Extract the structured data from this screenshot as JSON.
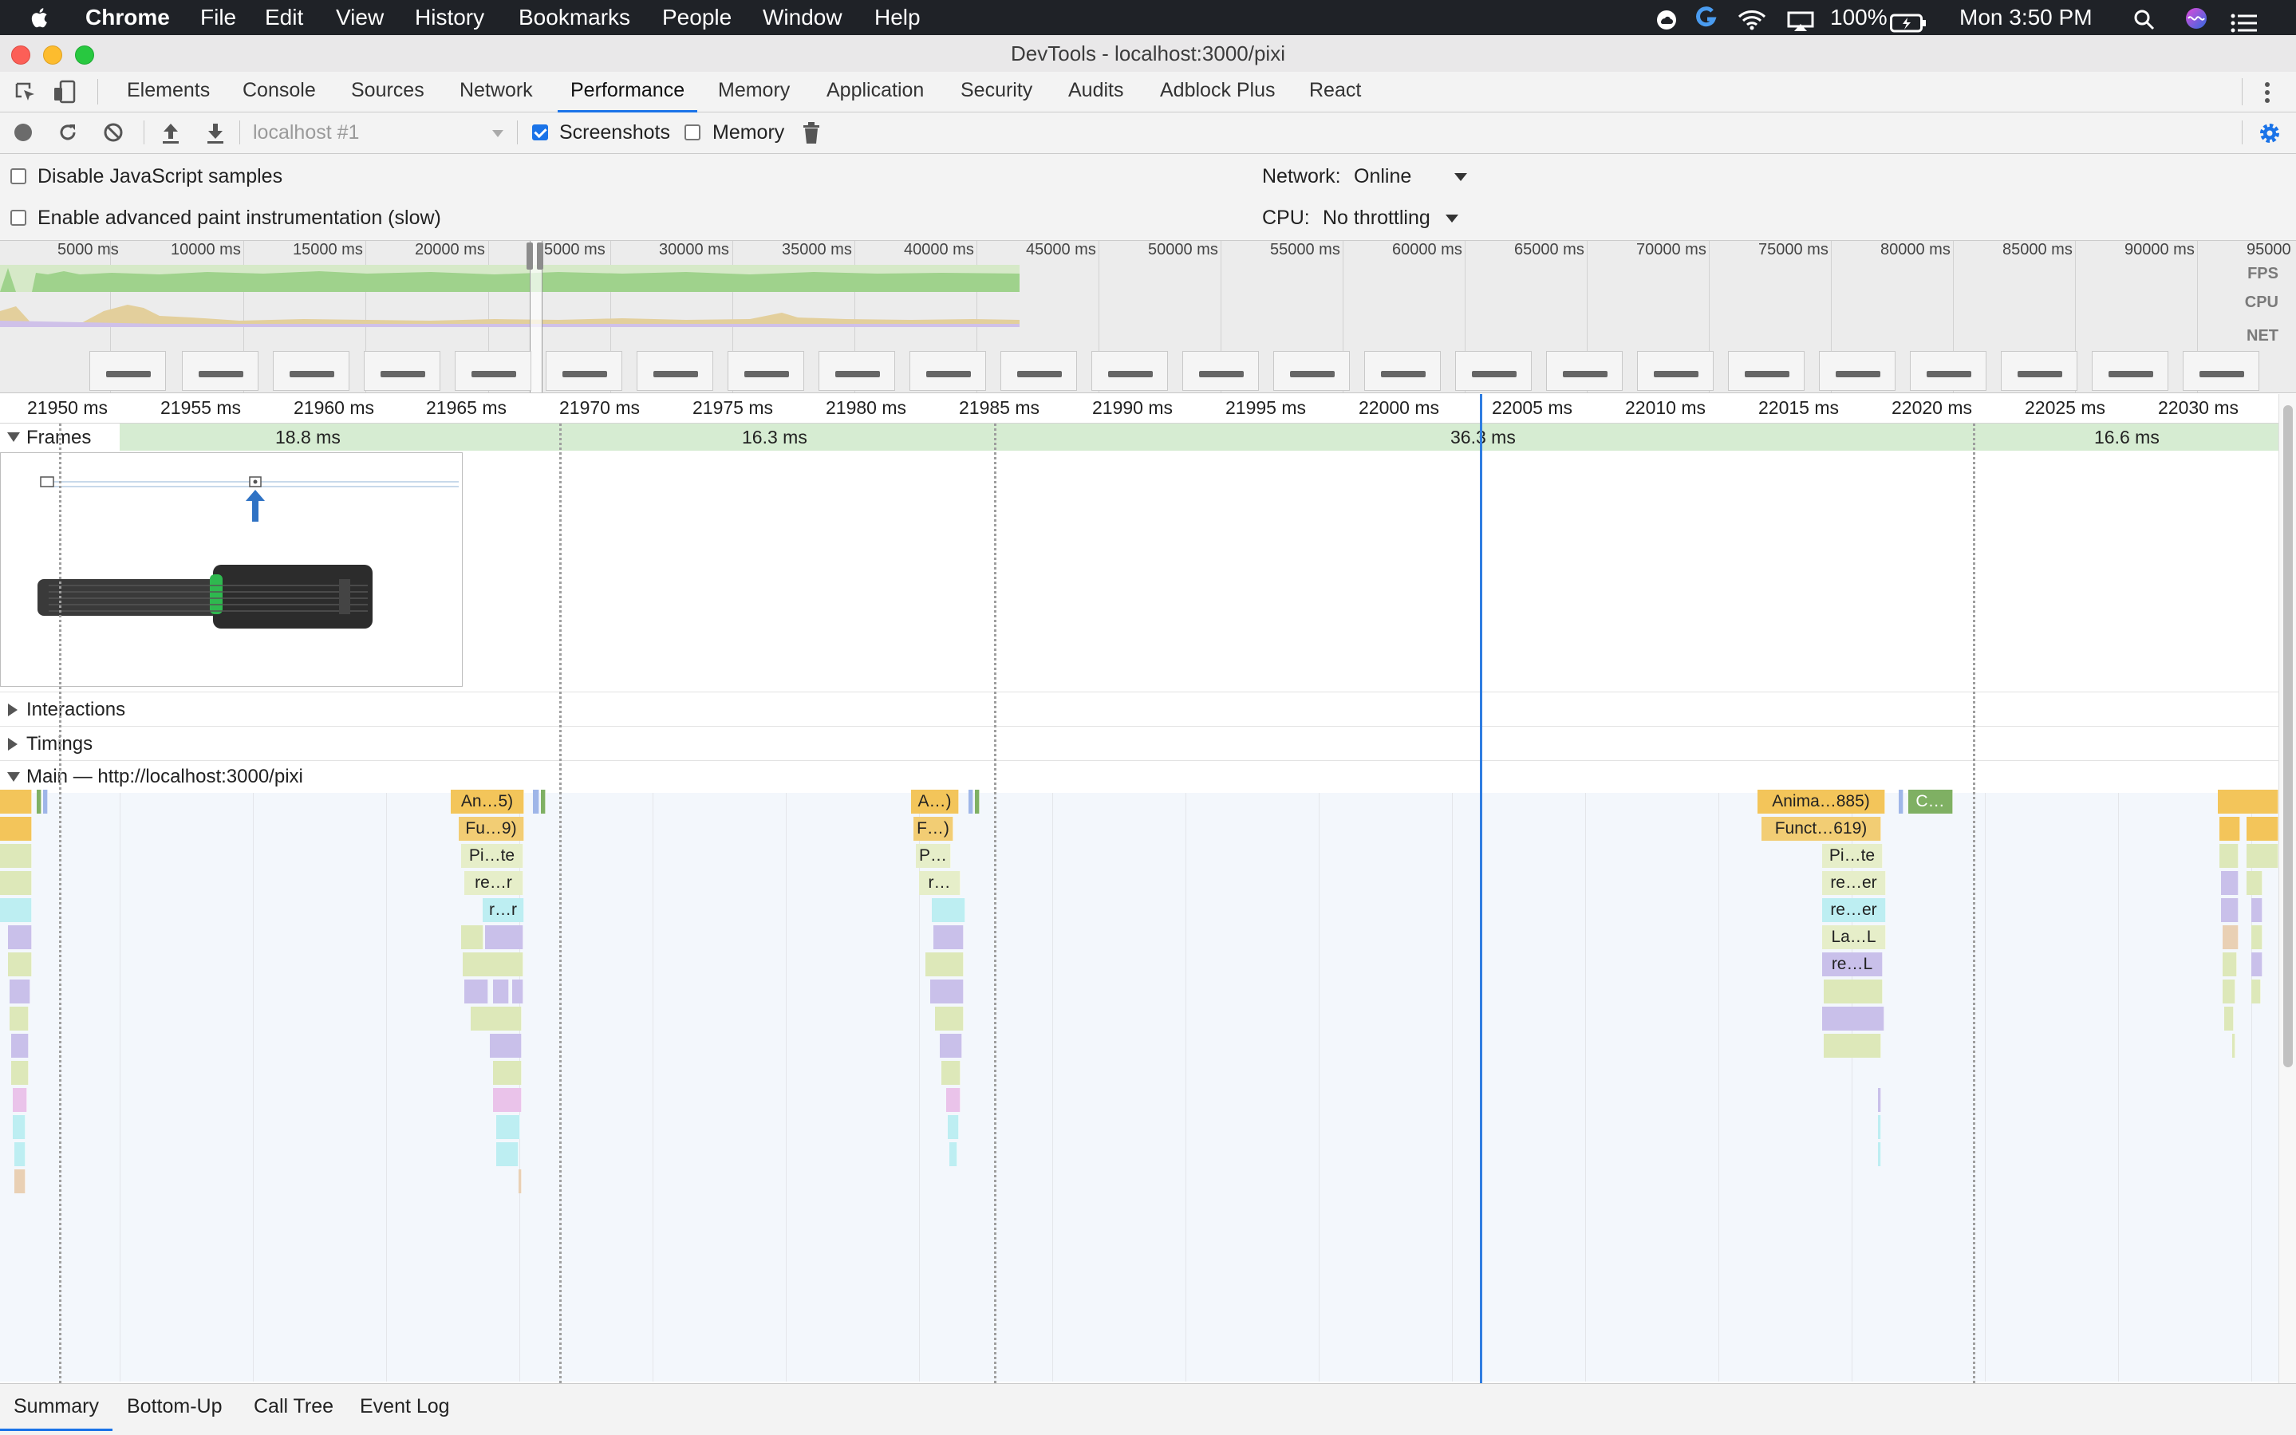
{
  "menubar": {
    "app_name": "Chrome",
    "items": [
      "File",
      "Edit",
      "View",
      "History",
      "Bookmarks",
      "People",
      "Window",
      "Help"
    ],
    "battery": "100%",
    "clock": "Mon 3:50 PM"
  },
  "window": {
    "title": "DevTools - localhost:3000/pixi"
  },
  "tabs": [
    "Elements",
    "Console",
    "Sources",
    "Network",
    "Performance",
    "Memory",
    "Application",
    "Security",
    "Audits",
    "Adblock Plus",
    "React"
  ],
  "active_tab": "Performance",
  "toolbar": {
    "profile_select": "localhost #1",
    "screenshots_label": "Screenshots",
    "screenshots_checked": true,
    "memory_label": "Memory",
    "memory_checked": false
  },
  "settings": {
    "disable_js_samples": "Disable JavaScript samples",
    "enable_paint": "Enable advanced paint instrumentation (slow)",
    "network_label": "Network:",
    "network_value": "Online",
    "cpu_label": "CPU:",
    "cpu_value": "No throttling"
  },
  "overview": {
    "ticks": [
      "5000 ms",
      "10000 ms",
      "15000 ms",
      "20000 ms",
      "5000 ms",
      "30000 ms",
      "35000 ms",
      "40000 ms",
      "45000 ms",
      "50000 ms",
      "55000 ms",
      "60000 ms",
      "65000 ms",
      "70000 ms",
      "75000 ms",
      "80000 ms",
      "85000 ms",
      "90000 ms",
      "95000 ms"
    ],
    "labels": {
      "fps": "FPS",
      "cpu": "CPU",
      "net": "NET"
    }
  },
  "ruler": {
    "ticks": [
      "21950 ms",
      "21955 ms",
      "21960 ms",
      "21965 ms",
      "21970 ms",
      "21975 ms",
      "21980 ms",
      "21985 ms",
      "21990 ms",
      "21995 ms",
      "22000 ms",
      "22005 ms",
      "22010 ms",
      "22015 ms",
      "22020 ms",
      "22025 ms",
      "22030 ms"
    ]
  },
  "tracks": {
    "frames": "Frames",
    "frame_durations": [
      "18.8 ms",
      "16.3 ms",
      "36.3 ms",
      "16.6 ms"
    ],
    "interactions": "Interactions",
    "timings": "Timings",
    "main": "Main — http://localhost:3000/pixi"
  },
  "flame": {
    "g1": [
      "An…5)",
      "Fu…9)",
      "Pi…te",
      "re…r",
      "r…r"
    ],
    "g2": [
      "A…)",
      "F…)",
      "P…",
      "r…"
    ],
    "g3": [
      "Anima…885)",
      "Funct…619)",
      "Pi…te",
      "re…er",
      "re…er",
      "La…L",
      "re…L"
    ],
    "g3_side": "C…"
  },
  "bottom_tabs": [
    "Summary",
    "Bottom-Up",
    "Call Tree",
    "Event Log"
  ],
  "active_bottom_tab": "Summary",
  "colors": {
    "accent": "#1a73e8",
    "scripting": "#f3c55a",
    "frames": "#d6ecd2"
  }
}
